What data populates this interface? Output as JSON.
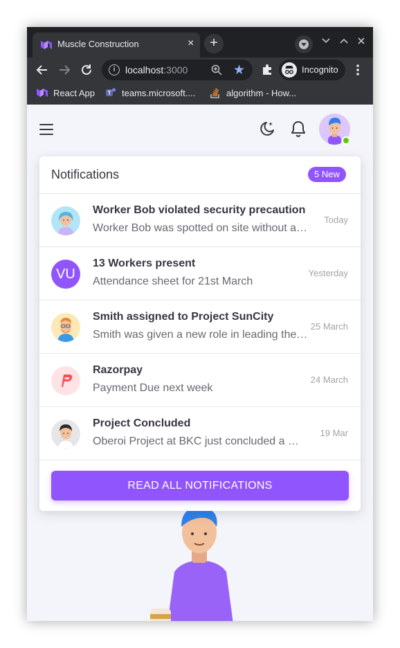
{
  "browser": {
    "tab_title": "Muscle Construction",
    "tab_close": "×",
    "new_tab": "+",
    "url_host": "localhost",
    "url_port": ":3000",
    "incognito_label": "Incognito",
    "bookmarks": [
      {
        "label": "React App",
        "icon": "mui-logo-icon"
      },
      {
        "label": "teams.microsoft....",
        "icon": "teams-icon"
      },
      {
        "label": "algorithm - How...",
        "icon": "stackoverflow-icon"
      }
    ]
  },
  "notifications": {
    "title": "Notifications",
    "new_badge": "5 New",
    "items": [
      {
        "title": "Worker Bob violated security precaution",
        "subtitle": "Worker Bob was spotted on site without a helmet",
        "time": "Today",
        "avatar": "worker-avatar"
      },
      {
        "title": "13 Workers present",
        "subtitle": "Attendance sheet for 21st March",
        "time": "Yesterday",
        "avatar_initials": "VU"
      },
      {
        "title": "Smith assigned to Project SunCity",
        "subtitle": "Smith was given a new role in leading the project",
        "time": "25 March",
        "avatar": "smith-avatar"
      },
      {
        "title": "Razorpay",
        "subtitle": "Payment Due next week",
        "time": "24 March",
        "avatar": "razorpay-logo"
      },
      {
        "title": "Project Concluded",
        "subtitle": "Oberoi Project at BKC just concluded a milestone",
        "time": "19 Mar",
        "avatar": "manager-avatar"
      }
    ],
    "read_all_label": "READ ALL NOTIFICATIONS"
  },
  "colors": {
    "primary": "#9155fd",
    "online": "#56ca00",
    "background": "#f4f5fa"
  }
}
